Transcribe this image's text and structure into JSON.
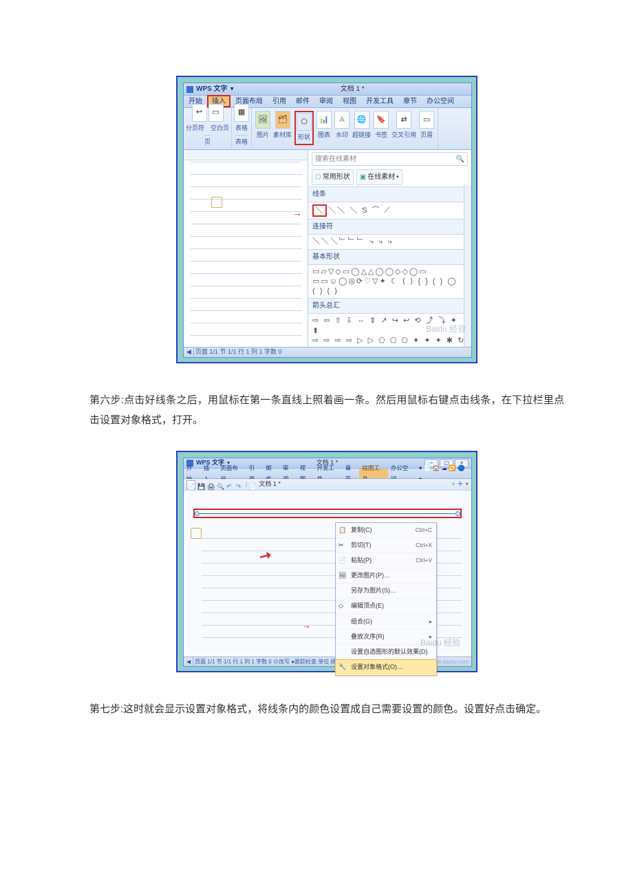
{
  "paragraphs": {
    "step6": "第六步:点击好线条之后，用鼠标在第一条直线上照着画一条。然后用鼠标右键点击线条，在下拉栏里点击设置对象格式，打开。",
    "step7": "第七步:这时就会显示设置对象格式，将线条内的颜色设置成自己需要设置的颜色。设置好点击确定。"
  },
  "fig1": {
    "appName": "WPS 文字",
    "docName": "文档 1 *",
    "tabs": [
      "开始",
      "插入",
      "页面布局",
      "引用",
      "邮件",
      "审阅",
      "视图",
      "开发工具",
      "章节",
      "办公空间"
    ],
    "activeTab": "插入",
    "ribbon": [
      {
        "label": "分页符",
        "icons": [
          "↩"
        ]
      },
      {
        "label": "空白页",
        "icons": [
          "▭"
        ]
      },
      {
        "group": "页"
      },
      {
        "label": "表格",
        "icons": [
          "▦"
        ]
      },
      {
        "group": "表格"
      },
      {
        "label": "图片",
        "icons": [
          "🖼"
        ]
      },
      {
        "label": "素材库",
        "icons": [
          "🗂"
        ]
      },
      {
        "label": "形状",
        "icons": [
          "⬠"
        ],
        "highlight": true
      },
      {
        "label": "图表",
        "icons": [
          "📊"
        ]
      },
      {
        "label": "水印",
        "icons": [
          "A"
        ]
      },
      {
        "label": "超链接",
        "icons": [
          "🌐"
        ]
      },
      {
        "label": "书签",
        "icons": [
          "🔖"
        ]
      },
      {
        "label": "交叉引用",
        "icons": [
          "⇄"
        ]
      },
      {
        "label": "页眉",
        "icons": [
          "▭"
        ]
      }
    ],
    "searchPlaceholder": "搜索在线素材",
    "btnCommon": "常用形状",
    "btnOnline": "在线素材",
    "categories": {
      "lines": {
        "name": "线条",
        "glyphs": "＼＼ ＼ S ⌒ ⟋"
      },
      "connectors": {
        "name": "连接符",
        "glyphs": "＼＼＼﹂﹂﹂ ⤷ ⤷ ⤷"
      },
      "basic": {
        "name": "基本形状",
        "glyphs": "▭▱▽◇▭◯△△◯◯◇◇◯▭\n▭▭☺◯◎⟳♡▽✦ ☾ ⟨ ⟩ { } ( ) ◯\n( ) ( )"
      },
      "arrows": {
        "name": "箭头总汇",
        "glyphs": "⇨ ⇦ ⇧ ⇩ ⇔ ⇕ ↗ ↪ ↩ ⟲ ⤴ ⤵ ✦ ⬆\n⇨ ⇨ ⇨ ⇨ ▷ ▷ ⬠ ⬠ ⬠ ✦ ✦ ✦ ✱ ↻"
      }
    },
    "status": "页面 1/1  节 1/1  行 1  列 1  字数 0",
    "watermark": "Baidu 经验"
  },
  "fig2": {
    "appName": "WPS 文字",
    "docName": "文档 1 *",
    "tabs": [
      "开始",
      "插入",
      "页面布局",
      "引用",
      "邮件",
      "审阅",
      "视图",
      "开发工具",
      "章节",
      "绘图工具",
      "办公空间"
    ],
    "hlTab": "绘图工具",
    "qatDoc": "文档 1 *",
    "ctx": [
      {
        "label": "复制(C)",
        "short": "Ctrl+C",
        "icon": "📋"
      },
      {
        "label": "剪切(T)",
        "short": "Ctrl+X",
        "icon": "✂"
      },
      {
        "label": "粘贴(P)",
        "short": "Ctrl+V",
        "icon": "📄"
      },
      {
        "label": "更改图片(P)…",
        "icon": "🖼"
      },
      {
        "label": "另存为图片(S)…"
      },
      {
        "label": "编辑顶点(E)",
        "icon": "◇"
      },
      {
        "label": "组合(G)",
        "arrow": true
      },
      {
        "label": "叠放次序(R)",
        "arrow": true
      },
      {
        "label": "设置自选图形的默认效果(D)"
      },
      {
        "label": "设置对象格式(O)…",
        "icon": "🔧",
        "hl": true
      }
    ],
    "status": "页面 1/1  节 1/1  行 1  列 1  字数 0  ⊘改写  ●跟踪检查  单位 磅",
    "watermark": "Baidu 经验",
    "wmUrl": "jingyan.baidu.com"
  }
}
